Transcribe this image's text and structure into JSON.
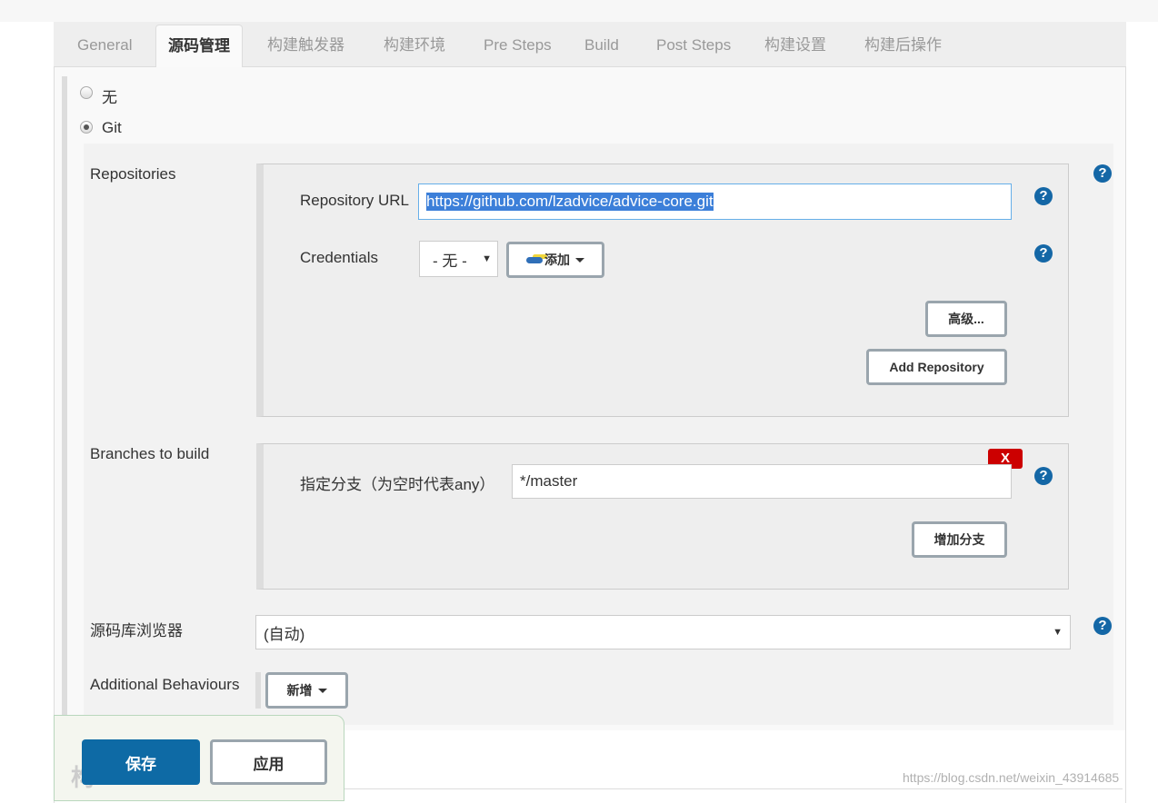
{
  "tabs": [
    {
      "label": "General"
    },
    {
      "label": "源码管理"
    },
    {
      "label": "构建触发器"
    },
    {
      "label": "构建环境"
    },
    {
      "label": "Pre Steps"
    },
    {
      "label": "Build"
    },
    {
      "label": "Post Steps"
    },
    {
      "label": "构建设置"
    },
    {
      "label": "构建后操作"
    }
  ],
  "scm": {
    "none_label": "无",
    "git_label": "Git",
    "selected": "Git"
  },
  "repositories": {
    "label": "Repositories",
    "url_label": "Repository URL",
    "url_value": "https://github.com/lzadvice/advice-core.git",
    "credentials_label": "Credentials",
    "credentials_value": "- 无 -",
    "add_label": "添加",
    "advanced_label": "高级...",
    "add_repo_label": "Add Repository"
  },
  "branches": {
    "label": "Branches to build",
    "spec_label": "指定分支（为空时代表any）",
    "spec_value": "*/master",
    "delete_label": "X",
    "add_branch_label": "增加分支"
  },
  "browser": {
    "label": "源码库浏览器",
    "value": "(自动)"
  },
  "behaviours": {
    "label": "Additional Behaviours",
    "add_label": "新增"
  },
  "footer": {
    "save_label": "保存",
    "apply_label": "应用",
    "partial_heading": "构"
  },
  "watermark": "https://blog.csdn.net/weixin_43914685",
  "help_glyph": "?",
  "colors": {
    "primary": "#0e6aa5",
    "help": "#1467a6",
    "delete": "#cc0000"
  }
}
